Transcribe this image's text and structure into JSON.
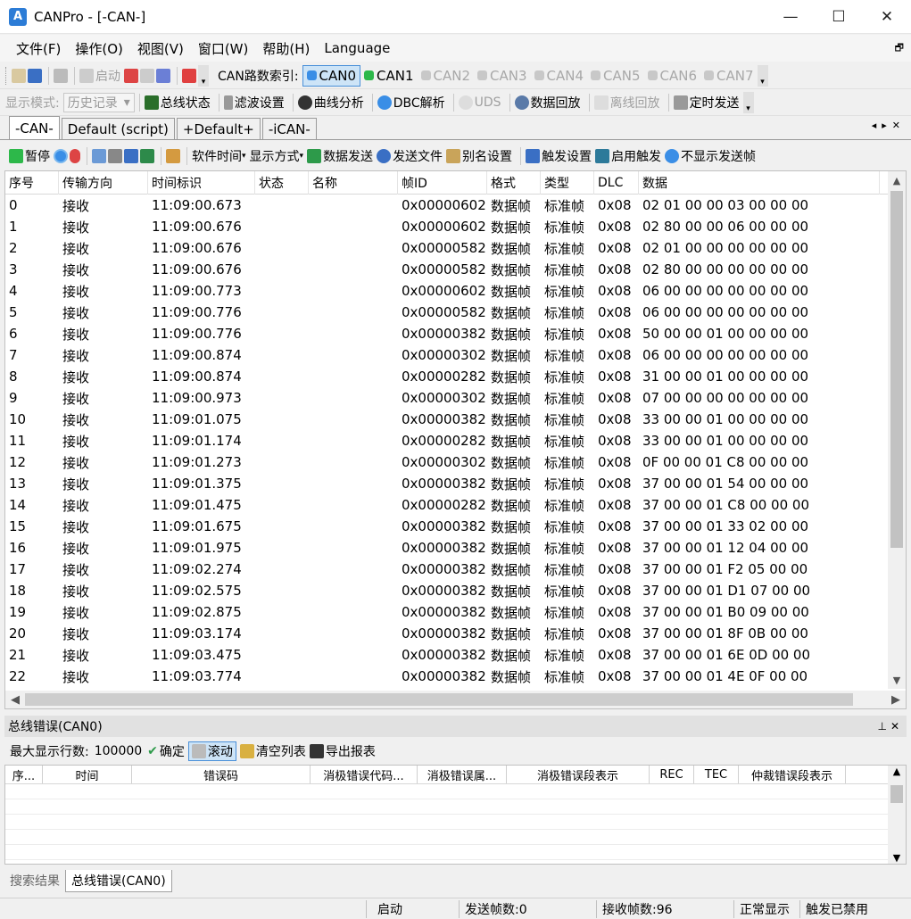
{
  "window": {
    "title": "CANPro - [-CAN-]",
    "min": "—",
    "max": "☐",
    "close": "✕"
  },
  "menu": [
    "文件(F)",
    "操作(O)",
    "视图(V)",
    "窗口(W)",
    "帮助(H)",
    "Language"
  ],
  "toolbar1": {
    "start_label": "启动",
    "can_index_label": "CAN路数索引:",
    "channels": [
      {
        "label": "CAN0",
        "active": true,
        "color": "#3a8ee6"
      },
      {
        "label": "CAN1",
        "active": false,
        "color": "#2db84a"
      },
      {
        "label": "CAN2",
        "active": false,
        "color": "#c8c8c8"
      },
      {
        "label": "CAN3",
        "active": false,
        "color": "#c8c8c8"
      },
      {
        "label": "CAN4",
        "active": false,
        "color": "#c8c8c8"
      },
      {
        "label": "CAN5",
        "active": false,
        "color": "#c8c8c8"
      },
      {
        "label": "CAN6",
        "active": false,
        "color": "#c8c8c8"
      },
      {
        "label": "CAN7",
        "active": false,
        "color": "#c8c8c8"
      }
    ]
  },
  "toolbar2": {
    "display_mode_label": "显示模式:",
    "display_mode_value": "历史记录",
    "bus_status": "总线状态",
    "filter": "滤波设置",
    "curve": "曲线分析",
    "dbc": "DBC解析",
    "uds": "UDS",
    "replay": "数据回放",
    "offline_replay": "离线回放",
    "timed_send": "定时发送"
  },
  "tabs": [
    "-CAN-",
    "Default (script)",
    "+Default+",
    "-iCAN-"
  ],
  "list_toolbar": {
    "pause": "暂停",
    "soft_time": "软件时间",
    "display_way": "显示方式",
    "data_send": "数据发送",
    "send_file": "发送文件",
    "alias": "别名设置",
    "trigger_settings": "触发设置",
    "enable_trigger": "启用触发",
    "hide_sent": "不显示发送帧"
  },
  "grid": {
    "columns": [
      "序号",
      "传输方向",
      "时间标识",
      "状态",
      "名称",
      "帧ID",
      "格式",
      "类型",
      "DLC",
      "数据"
    ],
    "rows": [
      [
        "0",
        "接收",
        "11:09:00.673",
        "",
        "",
        "0x00000602",
        "数据帧",
        "标准帧",
        "0x08",
        "02 01 00 00 03 00 00 00"
      ],
      [
        "1",
        "接收",
        "11:09:00.676",
        "",
        "",
        "0x00000602",
        "数据帧",
        "标准帧",
        "0x08",
        "02 80 00 00 06 00 00 00"
      ],
      [
        "2",
        "接收",
        "11:09:00.676",
        "",
        "",
        "0x00000582",
        "数据帧",
        "标准帧",
        "0x08",
        "02 01 00 00 00 00 00 00"
      ],
      [
        "3",
        "接收",
        "11:09:00.676",
        "",
        "",
        "0x00000582",
        "数据帧",
        "标准帧",
        "0x08",
        "02 80 00 00 00 00 00 00"
      ],
      [
        "4",
        "接收",
        "11:09:00.773",
        "",
        "",
        "0x00000602",
        "数据帧",
        "标准帧",
        "0x08",
        "06 00 00 00 00 00 00 00"
      ],
      [
        "5",
        "接收",
        "11:09:00.776",
        "",
        "",
        "0x00000582",
        "数据帧",
        "标准帧",
        "0x08",
        "06 00 00 00 00 00 00 00"
      ],
      [
        "6",
        "接收",
        "11:09:00.776",
        "",
        "",
        "0x00000382",
        "数据帧",
        "标准帧",
        "0x08",
        "50 00 00 01 00 00 00 00"
      ],
      [
        "7",
        "接收",
        "11:09:00.874",
        "",
        "",
        "0x00000302",
        "数据帧",
        "标准帧",
        "0x08",
        "06 00 00 00 00 00 00 00"
      ],
      [
        "8",
        "接收",
        "11:09:00.874",
        "",
        "",
        "0x00000282",
        "数据帧",
        "标准帧",
        "0x08",
        "31 00 00 01 00 00 00 00"
      ],
      [
        "9",
        "接收",
        "11:09:00.973",
        "",
        "",
        "0x00000302",
        "数据帧",
        "标准帧",
        "0x08",
        "07 00 00 00 00 00 00 00"
      ],
      [
        "10",
        "接收",
        "11:09:01.075",
        "",
        "",
        "0x00000382",
        "数据帧",
        "标准帧",
        "0x08",
        "33 00 00 01 00 00 00 00"
      ],
      [
        "11",
        "接收",
        "11:09:01.174",
        "",
        "",
        "0x00000282",
        "数据帧",
        "标准帧",
        "0x08",
        "33 00 00 01 00 00 00 00"
      ],
      [
        "12",
        "接收",
        "11:09:01.273",
        "",
        "",
        "0x00000302",
        "数据帧",
        "标准帧",
        "0x08",
        "0F 00 00 01 C8 00 00 00"
      ],
      [
        "13",
        "接收",
        "11:09:01.375",
        "",
        "",
        "0x00000382",
        "数据帧",
        "标准帧",
        "0x08",
        "37 00 00 01 54 00 00 00"
      ],
      [
        "14",
        "接收",
        "11:09:01.475",
        "",
        "",
        "0x00000282",
        "数据帧",
        "标准帧",
        "0x08",
        "37 00 00 01 C8 00 00 00"
      ],
      [
        "15",
        "接收",
        "11:09:01.675",
        "",
        "",
        "0x00000382",
        "数据帧",
        "标准帧",
        "0x08",
        "37 00 00 01 33 02 00 00"
      ],
      [
        "16",
        "接收",
        "11:09:01.975",
        "",
        "",
        "0x00000382",
        "数据帧",
        "标准帧",
        "0x08",
        "37 00 00 01 12 04 00 00"
      ],
      [
        "17",
        "接收",
        "11:09:02.274",
        "",
        "",
        "0x00000382",
        "数据帧",
        "标准帧",
        "0x08",
        "37 00 00 01 F2 05 00 00"
      ],
      [
        "18",
        "接收",
        "11:09:02.575",
        "",
        "",
        "0x00000382",
        "数据帧",
        "标准帧",
        "0x08",
        "37 00 00 01 D1 07 00 00"
      ],
      [
        "19",
        "接收",
        "11:09:02.875",
        "",
        "",
        "0x00000382",
        "数据帧",
        "标准帧",
        "0x08",
        "37 00 00 01 B0 09 00 00"
      ],
      [
        "20",
        "接收",
        "11:09:03.174",
        "",
        "",
        "0x00000382",
        "数据帧",
        "标准帧",
        "0x08",
        "37 00 00 01 8F 0B 00 00"
      ],
      [
        "21",
        "接收",
        "11:09:03.475",
        "",
        "",
        "0x00000382",
        "数据帧",
        "标准帧",
        "0x08",
        "37 00 00 01 6E 0D 00 00"
      ],
      [
        "22",
        "接收",
        "11:09:03.774",
        "",
        "",
        "0x00000382",
        "数据帧",
        "标准帧",
        "0x08",
        "37 00 00 01 4E 0F 00 00"
      ]
    ]
  },
  "error_panel": {
    "title": "总线错误(CAN0)",
    "max_rows_label": "最大显示行数:",
    "max_rows_value": "100000",
    "confirm": "确定",
    "scroll": "滚动",
    "clear": "清空列表",
    "export": "导出报表",
    "columns": [
      "序...",
      "时间",
      "错误码",
      "消极错误代码...",
      "消极错误属...",
      "消极错误段表示",
      "REC",
      "TEC",
      "仲裁错误段表示"
    ]
  },
  "bottom_tabs": [
    "搜索结果",
    "总线错误(CAN0)"
  ],
  "status": {
    "state": "启动",
    "sent": "发送帧数:0",
    "received": "接收帧数:96",
    "display": "正常显示",
    "trigger": "触发已禁用"
  }
}
